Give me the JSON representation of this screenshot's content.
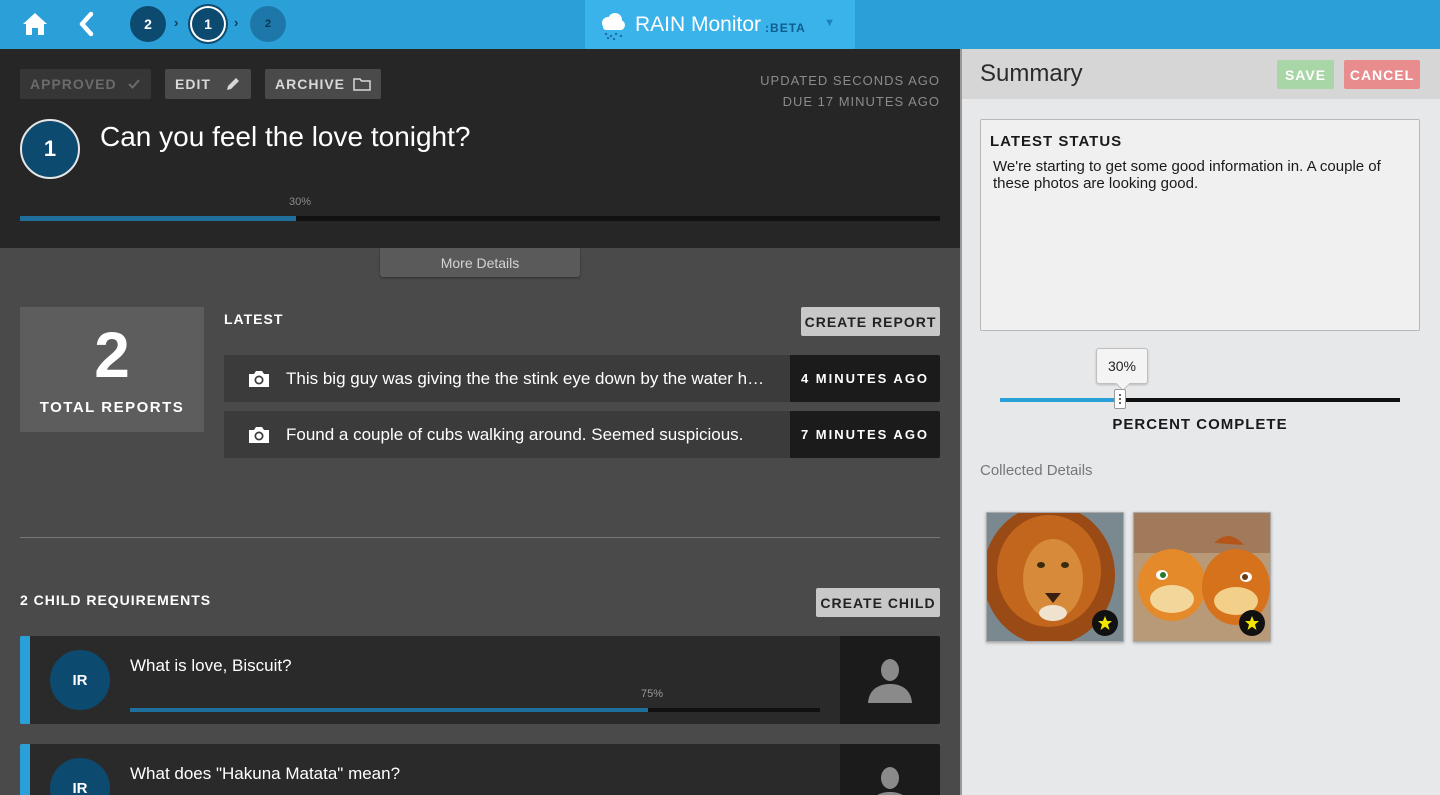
{
  "nav": {
    "crumbs": [
      "2",
      "1",
      "2"
    ],
    "brand_name": "RAIN Monitor",
    "brand_tag": ":BETA"
  },
  "header": {
    "approved_label": "APPROVED",
    "edit_label": "EDIT",
    "archive_label": "ARCHIVE",
    "updated": "UPDATED SECONDS AGO",
    "due": "DUE 17 MINUTES AGO",
    "number": "1",
    "title": "Can you feel the love tonight?",
    "progress_label": "30%",
    "progress": 0.3,
    "more_details": "More Details"
  },
  "reports": {
    "total": "2",
    "total_label": "TOTAL REPORTS",
    "latest_label": "LATEST",
    "create_label": "CREATE REPORT",
    "items": [
      {
        "text": "This big guy was giving the the stink eye down by the water h…",
        "time": "4 MINUTES AGO",
        "icon": "camera-icon"
      },
      {
        "text": "Found a couple of cubs walking around. Seemed suspicious.",
        "time": "7 MINUTES AGO",
        "icon": "camera-icon"
      }
    ]
  },
  "children": {
    "heading": "2 CHILD REQUIREMENTS",
    "create_label": "CREATE CHILD",
    "items": [
      {
        "initials": "IR",
        "title": "What is love, Biscuit?",
        "pct_label": "75%",
        "progress": 0.75
      },
      {
        "initials": "IR",
        "title": "What does \"Hakuna Matata\" mean?",
        "pct_label": "",
        "progress": 0
      }
    ]
  },
  "summary": {
    "title": "Summary",
    "save_label": "SAVE",
    "cancel_label": "CANCEL",
    "status_heading": "LATEST STATUS",
    "status_text": "We're starting to get some good information in. A couple of these photos are looking good.",
    "slider_value_label": "30%",
    "slider_value": 0.3,
    "slider_label": "PERCENT COMPLETE",
    "collected_label": "Collected Details"
  },
  "colors": {
    "accent": "#2a9fd8",
    "dark_blue": "#0d4a6f",
    "save": "#a9d6a6",
    "cancel": "#e88c8e"
  }
}
